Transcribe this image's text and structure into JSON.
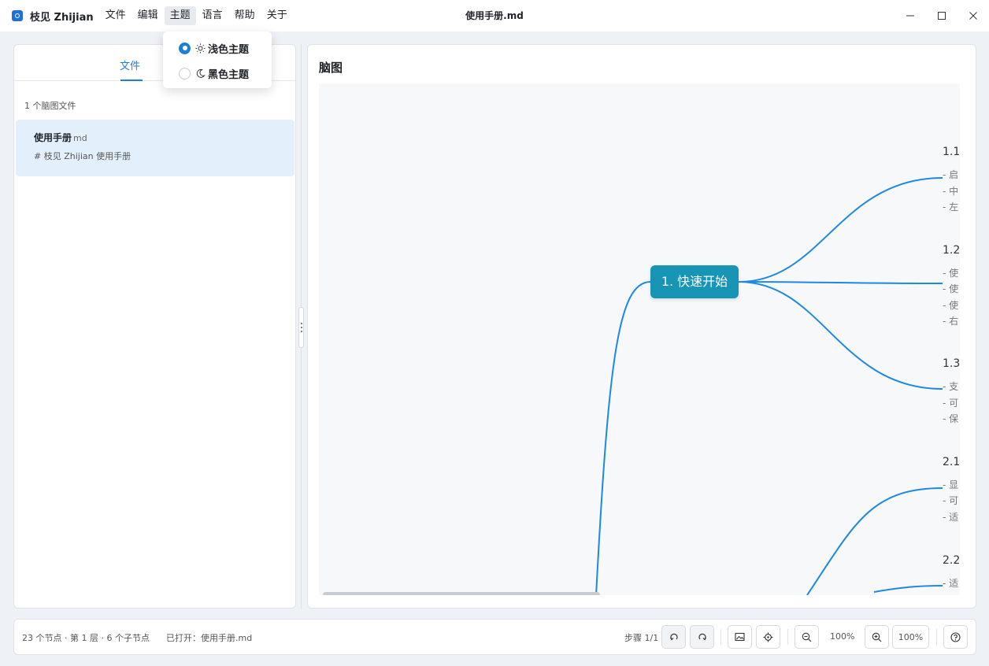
{
  "app": {
    "name": "枝见 Zhijian",
    "window_title": "使用手册.md"
  },
  "menu": [
    "文件",
    "编辑",
    "主题",
    "语言",
    "帮助",
    "关于"
  ],
  "theme_menu": {
    "options": [
      {
        "label": "浅色主题",
        "icon": "sun-icon",
        "selected": true
      },
      {
        "label": "黑色主题",
        "icon": "moon-icon",
        "selected": false
      }
    ]
  },
  "sidebar": {
    "tab": "文件",
    "file_count": "1 个脑图文件",
    "files": [
      {
        "name": "使用手册",
        "ext": "md",
        "preview": "# 枝见 Zhijian 使用手册"
      }
    ]
  },
  "main": {
    "title": "脑图",
    "root": "1. 快速开始",
    "children": [
      {
        "label": "1.1",
        "lines": [
          "- 启",
          "- 中",
          "- 左"
        ]
      },
      {
        "label": "1.2",
        "lines": [
          "- 使",
          "- 使",
          "- 使",
          "- 右"
        ]
      },
      {
        "label": "1.3",
        "lines": [
          "- 支",
          "- 可",
          "- 保"
        ]
      },
      {
        "label": "2.1",
        "lines": [
          "- 显",
          "- 可",
          "- 适"
        ]
      },
      {
        "label": "2.2",
        "lines": [
          "- 适"
        ]
      }
    ],
    "colors": {
      "root": "#1894b4",
      "edge": "#1e88e5"
    }
  },
  "status": {
    "info": "23 个节点 · 第 1 层 · 6 个子节点",
    "opened": "已打开：使用手册.md",
    "step": "步骤 1/1",
    "zoom": "100%",
    "zoom_button": "100%"
  }
}
